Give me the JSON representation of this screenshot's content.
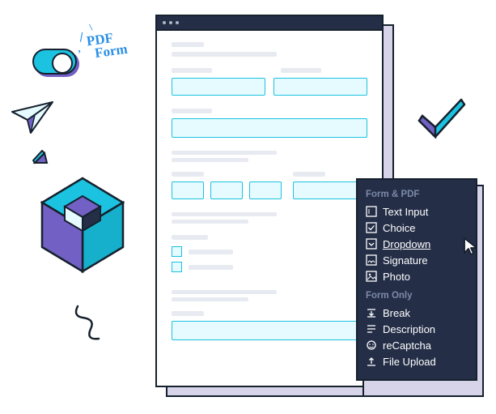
{
  "decor": {
    "pdf_label_line1": "PDF",
    "pdf_label_line2": "Form"
  },
  "menu": {
    "heading_form_pdf": "Form & PDF",
    "heading_form_only": "Form Only",
    "items_form_pdf": [
      {
        "label": "Text Input",
        "icon": "text-input-icon"
      },
      {
        "label": "Choice",
        "icon": "choice-icon"
      },
      {
        "label": "Dropdown",
        "icon": "dropdown-icon"
      },
      {
        "label": "Signature",
        "icon": "signature-icon"
      },
      {
        "label": "Photo",
        "icon": "photo-icon"
      }
    ],
    "items_form_only": [
      {
        "label": "Break",
        "icon": "break-icon"
      },
      {
        "label": "Description",
        "icon": "description-icon"
      },
      {
        "label": "reCaptcha",
        "icon": "recaptcha-icon"
      },
      {
        "label": "File Upload",
        "icon": "upload-icon"
      }
    ],
    "hovered": "Dropdown"
  }
}
